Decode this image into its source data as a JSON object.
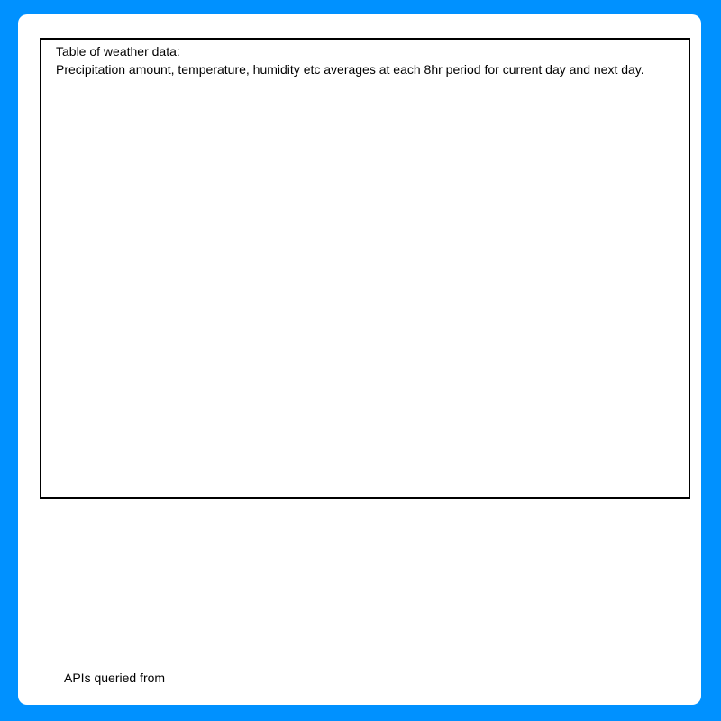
{
  "panel": {
    "weather_table": {
      "title": "Table of weather data:",
      "description": "Precipitation amount, temperature, humidity etc averages at each 8hr period for current day and next day."
    },
    "apis_label": "APIs queried from"
  },
  "colors": {
    "background": "#0091ff",
    "panel": "#ffffff",
    "border": "#000000"
  }
}
